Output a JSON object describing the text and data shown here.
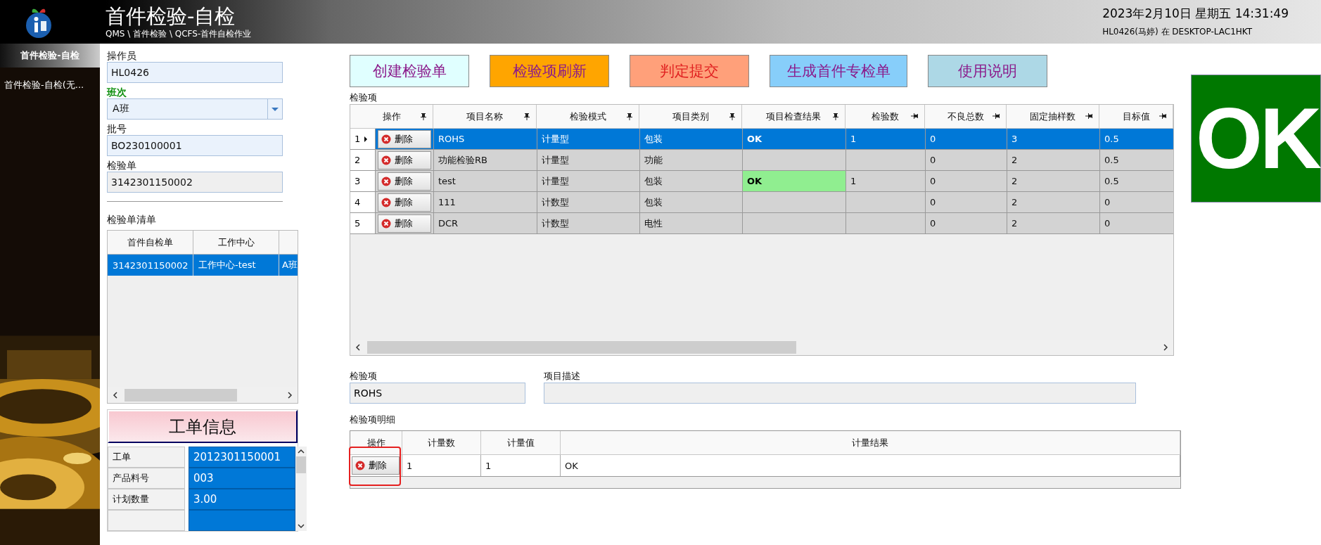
{
  "header": {
    "title": "首件检验-自检",
    "breadcrumb": "QMS \\ 首件检验 \\ QCFS-首件自检作业",
    "datetime": "2023年2月10日 星期五 14:31:49",
    "user": "HL0426(马婷) 在 DESKTOP-LAC1HKT"
  },
  "sidebar": {
    "items": [
      {
        "label": "首件检验-自检",
        "selected": true
      },
      {
        "label": "首件检验-自检(无...",
        "selected": false
      }
    ]
  },
  "form": {
    "fields": [
      {
        "kind": "text",
        "label": "操作员",
        "value": "HL0426",
        "required": false,
        "readonly": false
      },
      {
        "kind": "combo",
        "label": "班次",
        "value": "A班",
        "required": true,
        "readonly": false
      },
      {
        "kind": "text",
        "label": "批号",
        "value": "BO230100001",
        "required": false,
        "readonly": false
      },
      {
        "kind": "text",
        "label": "检验单",
        "value": "3142301150002",
        "required": false,
        "readonly": true
      }
    ],
    "list_title": "检验单清单",
    "list": {
      "columns": [
        "首件自检单",
        "工作中心"
      ],
      "rows": [
        {
          "cells": [
            "3142301150002",
            "工作中心-test",
            "A班"
          ],
          "selected": true
        }
      ]
    },
    "order_info": {
      "title": "工单信息",
      "rows": [
        {
          "label": "工单",
          "value": "2012301150001"
        },
        {
          "label": "产品料号",
          "value": "003"
        },
        {
          "label": "计划数量",
          "value": "3.00"
        }
      ]
    }
  },
  "toolbar": [
    {
      "label": "创建检验单",
      "color": "#e0ffff"
    },
    {
      "label": "检验项刷新",
      "color": "#ffa500"
    },
    {
      "label": "判定提交",
      "color": "#ffa07a"
    },
    {
      "label": "生成首件专检单",
      "color": "#87cefa"
    },
    {
      "label": "使用说明",
      "color": "#add8e6"
    }
  ],
  "items": {
    "title": "检验项",
    "columns": [
      {
        "label": "操作",
        "pinned": true
      },
      {
        "label": "项目名称",
        "pinned": true
      },
      {
        "label": "检验模式",
        "pinned": true
      },
      {
        "label": "项目类别",
        "pinned": true
      },
      {
        "label": "项目检查结果",
        "pinned": true
      },
      {
        "label": "检验数",
        "pinned": false
      },
      {
        "label": "不良总数",
        "pinned": false
      },
      {
        "label": "固定抽样数",
        "pinned": false
      },
      {
        "label": "目标值",
        "pinned": false
      }
    ],
    "rows": [
      {
        "index": "1",
        "action": "删除",
        "selected": true,
        "result_highlight": false,
        "cells": [
          "ROHS",
          "计量型",
          "包装",
          "OK",
          "1",
          "0",
          "3",
          "0.5"
        ]
      },
      {
        "index": "2",
        "action": "删除",
        "selected": false,
        "result_highlight": false,
        "cells": [
          "功能检验RB",
          "计量型",
          "功能",
          "",
          "",
          "0",
          "2",
          "0.5"
        ]
      },
      {
        "index": "3",
        "action": "删除",
        "selected": false,
        "result_highlight": true,
        "cells": [
          "test",
          "计量型",
          "包装",
          "OK",
          "1",
          "0",
          "2",
          "0.5"
        ]
      },
      {
        "index": "4",
        "action": "删除",
        "selected": false,
        "result_highlight": false,
        "cells": [
          "111",
          "计数型",
          "包装",
          "",
          "",
          "0",
          "2",
          "0"
        ]
      },
      {
        "index": "5",
        "action": "删除",
        "selected": false,
        "result_highlight": false,
        "cells": [
          "DCR",
          "计数型",
          "电性",
          "",
          "",
          "0",
          "2",
          "0"
        ]
      }
    ]
  },
  "item_field": {
    "label": "检验项",
    "value": "ROHS"
  },
  "desc_field": {
    "label": "项目描述"
  },
  "detail": {
    "title": "检验项明细",
    "columns": [
      "操作",
      "计量数",
      "计量值",
      "计量结果"
    ],
    "rows": [
      {
        "action": "删除",
        "cells": [
          "1",
          "1",
          "OK"
        ],
        "highlighted": true
      }
    ]
  },
  "verdict": {
    "text": "OK",
    "pass": true
  }
}
